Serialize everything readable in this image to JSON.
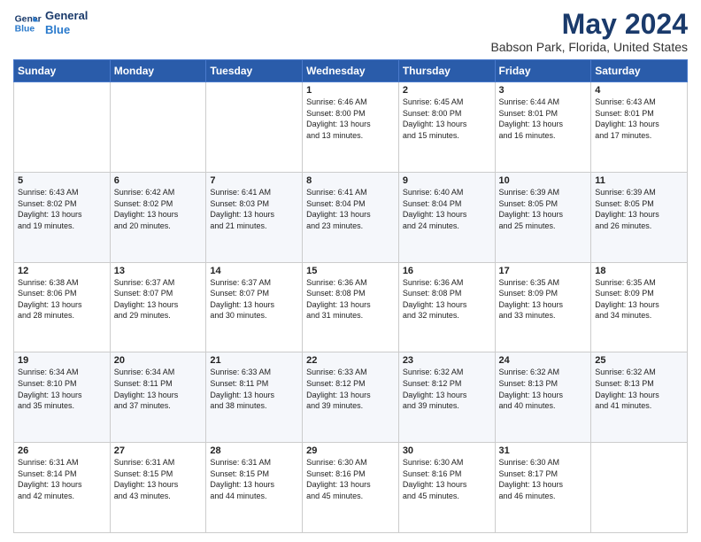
{
  "header": {
    "logo_line1": "General",
    "logo_line2": "Blue",
    "month": "May 2024",
    "location": "Babson Park, Florida, United States"
  },
  "days_of_week": [
    "Sunday",
    "Monday",
    "Tuesday",
    "Wednesday",
    "Thursday",
    "Friday",
    "Saturday"
  ],
  "weeks": [
    [
      {
        "day": "",
        "info": ""
      },
      {
        "day": "",
        "info": ""
      },
      {
        "day": "",
        "info": ""
      },
      {
        "day": "1",
        "info": "Sunrise: 6:46 AM\nSunset: 8:00 PM\nDaylight: 13 hours\nand 13 minutes."
      },
      {
        "day": "2",
        "info": "Sunrise: 6:45 AM\nSunset: 8:00 PM\nDaylight: 13 hours\nand 15 minutes."
      },
      {
        "day": "3",
        "info": "Sunrise: 6:44 AM\nSunset: 8:01 PM\nDaylight: 13 hours\nand 16 minutes."
      },
      {
        "day": "4",
        "info": "Sunrise: 6:43 AM\nSunset: 8:01 PM\nDaylight: 13 hours\nand 17 minutes."
      }
    ],
    [
      {
        "day": "5",
        "info": "Sunrise: 6:43 AM\nSunset: 8:02 PM\nDaylight: 13 hours\nand 19 minutes."
      },
      {
        "day": "6",
        "info": "Sunrise: 6:42 AM\nSunset: 8:02 PM\nDaylight: 13 hours\nand 20 minutes."
      },
      {
        "day": "7",
        "info": "Sunrise: 6:41 AM\nSunset: 8:03 PM\nDaylight: 13 hours\nand 21 minutes."
      },
      {
        "day": "8",
        "info": "Sunrise: 6:41 AM\nSunset: 8:04 PM\nDaylight: 13 hours\nand 23 minutes."
      },
      {
        "day": "9",
        "info": "Sunrise: 6:40 AM\nSunset: 8:04 PM\nDaylight: 13 hours\nand 24 minutes."
      },
      {
        "day": "10",
        "info": "Sunrise: 6:39 AM\nSunset: 8:05 PM\nDaylight: 13 hours\nand 25 minutes."
      },
      {
        "day": "11",
        "info": "Sunrise: 6:39 AM\nSunset: 8:05 PM\nDaylight: 13 hours\nand 26 minutes."
      }
    ],
    [
      {
        "day": "12",
        "info": "Sunrise: 6:38 AM\nSunset: 8:06 PM\nDaylight: 13 hours\nand 28 minutes."
      },
      {
        "day": "13",
        "info": "Sunrise: 6:37 AM\nSunset: 8:07 PM\nDaylight: 13 hours\nand 29 minutes."
      },
      {
        "day": "14",
        "info": "Sunrise: 6:37 AM\nSunset: 8:07 PM\nDaylight: 13 hours\nand 30 minutes."
      },
      {
        "day": "15",
        "info": "Sunrise: 6:36 AM\nSunset: 8:08 PM\nDaylight: 13 hours\nand 31 minutes."
      },
      {
        "day": "16",
        "info": "Sunrise: 6:36 AM\nSunset: 8:08 PM\nDaylight: 13 hours\nand 32 minutes."
      },
      {
        "day": "17",
        "info": "Sunrise: 6:35 AM\nSunset: 8:09 PM\nDaylight: 13 hours\nand 33 minutes."
      },
      {
        "day": "18",
        "info": "Sunrise: 6:35 AM\nSunset: 8:09 PM\nDaylight: 13 hours\nand 34 minutes."
      }
    ],
    [
      {
        "day": "19",
        "info": "Sunrise: 6:34 AM\nSunset: 8:10 PM\nDaylight: 13 hours\nand 35 minutes."
      },
      {
        "day": "20",
        "info": "Sunrise: 6:34 AM\nSunset: 8:11 PM\nDaylight: 13 hours\nand 37 minutes."
      },
      {
        "day": "21",
        "info": "Sunrise: 6:33 AM\nSunset: 8:11 PM\nDaylight: 13 hours\nand 38 minutes."
      },
      {
        "day": "22",
        "info": "Sunrise: 6:33 AM\nSunset: 8:12 PM\nDaylight: 13 hours\nand 39 minutes."
      },
      {
        "day": "23",
        "info": "Sunrise: 6:32 AM\nSunset: 8:12 PM\nDaylight: 13 hours\nand 39 minutes."
      },
      {
        "day": "24",
        "info": "Sunrise: 6:32 AM\nSunset: 8:13 PM\nDaylight: 13 hours\nand 40 minutes."
      },
      {
        "day": "25",
        "info": "Sunrise: 6:32 AM\nSunset: 8:13 PM\nDaylight: 13 hours\nand 41 minutes."
      }
    ],
    [
      {
        "day": "26",
        "info": "Sunrise: 6:31 AM\nSunset: 8:14 PM\nDaylight: 13 hours\nand 42 minutes."
      },
      {
        "day": "27",
        "info": "Sunrise: 6:31 AM\nSunset: 8:15 PM\nDaylight: 13 hours\nand 43 minutes."
      },
      {
        "day": "28",
        "info": "Sunrise: 6:31 AM\nSunset: 8:15 PM\nDaylight: 13 hours\nand 44 minutes."
      },
      {
        "day": "29",
        "info": "Sunrise: 6:30 AM\nSunset: 8:16 PM\nDaylight: 13 hours\nand 45 minutes."
      },
      {
        "day": "30",
        "info": "Sunrise: 6:30 AM\nSunset: 8:16 PM\nDaylight: 13 hours\nand 45 minutes."
      },
      {
        "day": "31",
        "info": "Sunrise: 6:30 AM\nSunset: 8:17 PM\nDaylight: 13 hours\nand 46 minutes."
      },
      {
        "day": "",
        "info": ""
      }
    ]
  ]
}
